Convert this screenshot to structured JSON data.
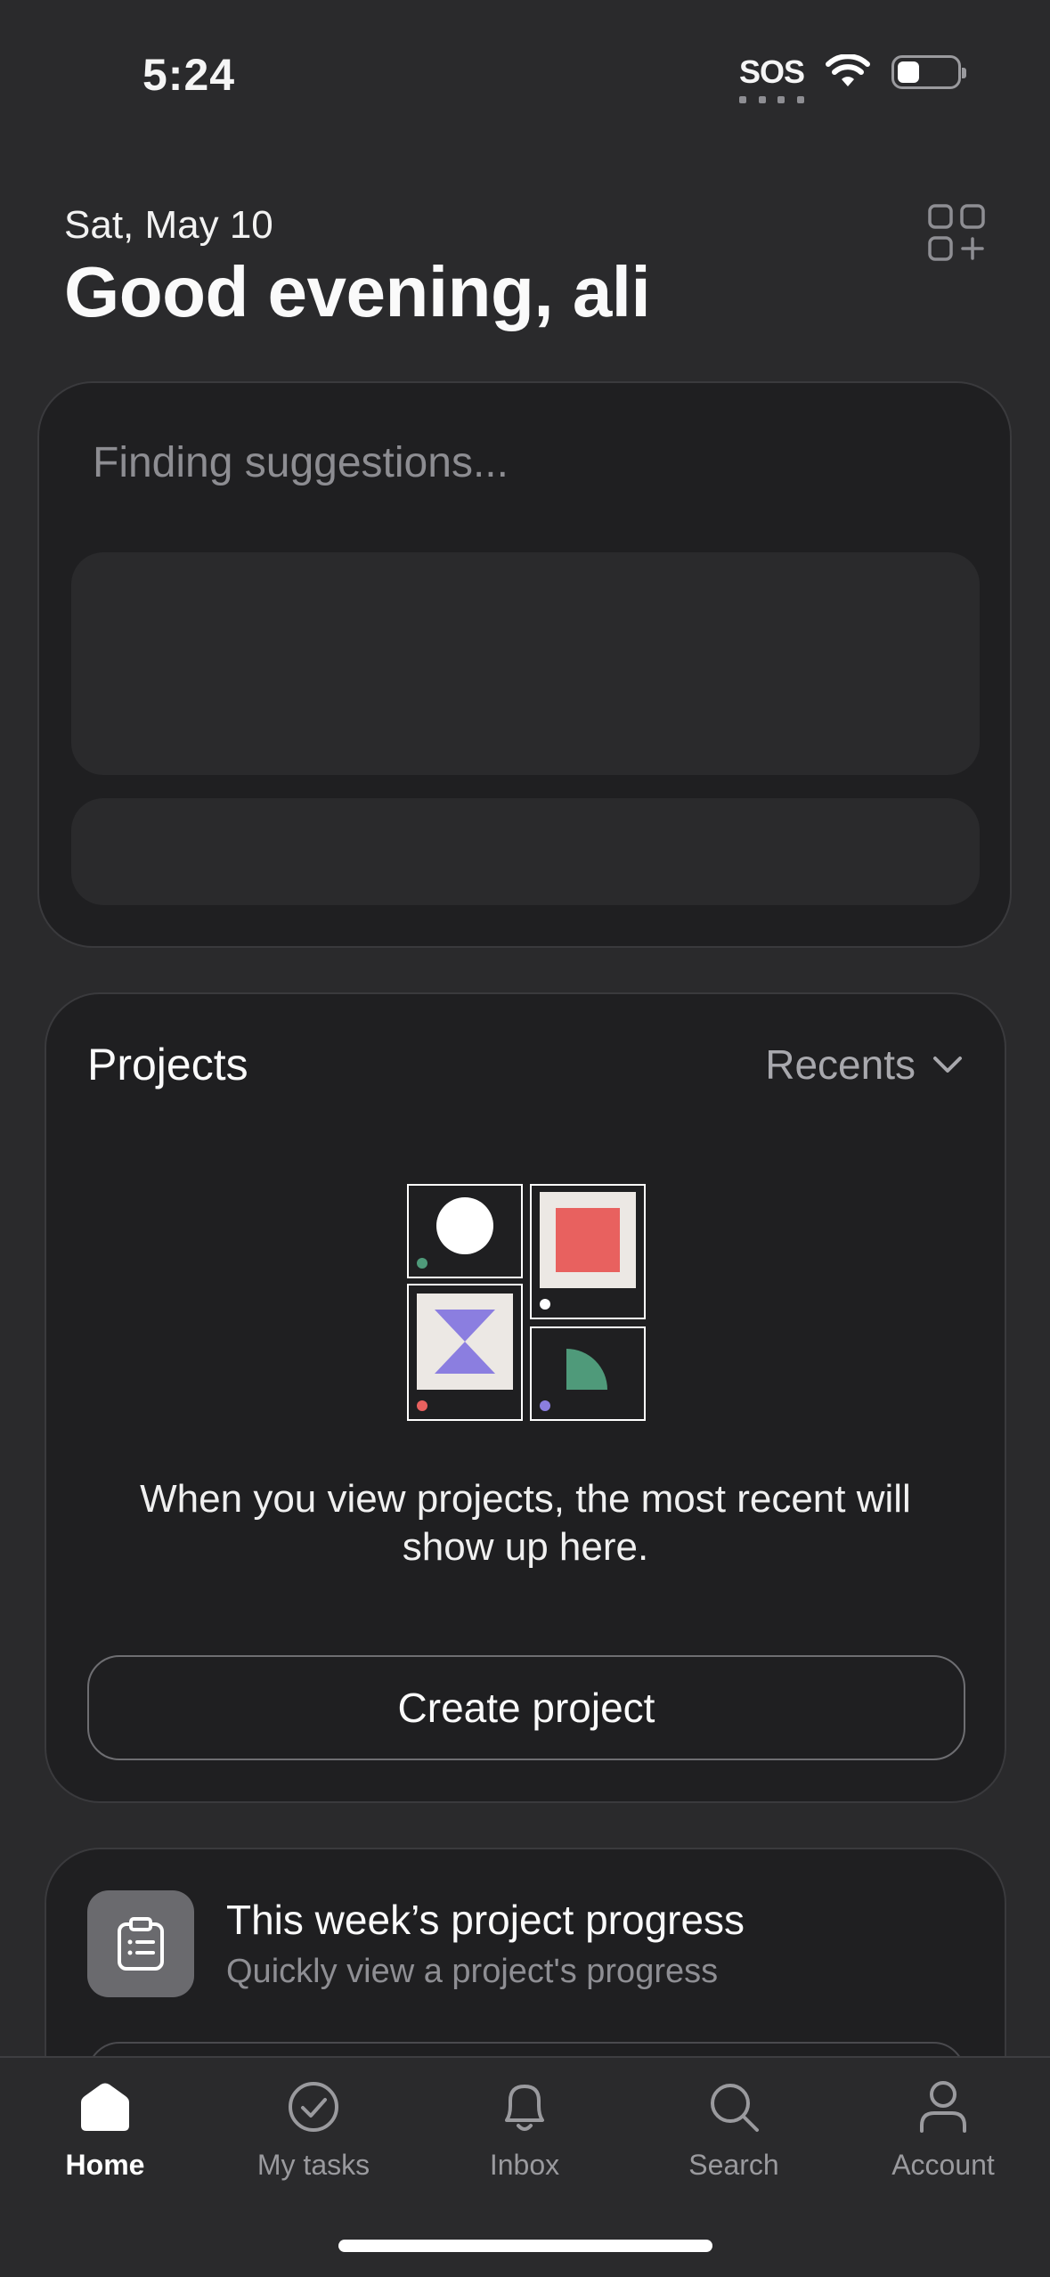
{
  "status_bar": {
    "time": "5:24",
    "sos": "SOS"
  },
  "header": {
    "date": "Sat, May 10",
    "greeting": "Good evening, ali"
  },
  "suggestions": {
    "title": "Finding suggestions..."
  },
  "projects": {
    "title": "Projects",
    "filter_label": "Recents",
    "empty_text": "When you view projects, the most recent will show up here.",
    "create_label": "Create project"
  },
  "progress": {
    "title": "This week’s project progress",
    "subtitle": "Quickly view a project's progress"
  },
  "tabbar": {
    "items": [
      {
        "label": "Home",
        "icon": "home-icon",
        "active": true
      },
      {
        "label": "My tasks",
        "icon": "check-circle-icon"
      },
      {
        "label": "Inbox",
        "icon": "bell-icon"
      },
      {
        "label": "Search",
        "icon": "search-icon"
      },
      {
        "label": "Account",
        "icon": "person-icon"
      }
    ]
  },
  "colors": {
    "background": "#2a2a2c",
    "card": "#1f1f21",
    "illustration_red": "#e8615f",
    "illustration_purple": "#8b7ee0",
    "illustration_green": "#4f9a7a"
  }
}
